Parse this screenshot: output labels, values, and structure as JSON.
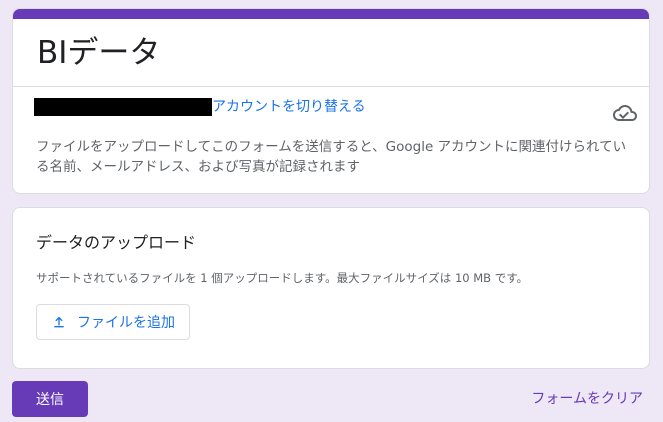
{
  "form": {
    "title": "BIデータ",
    "accent_color": "#673ab7"
  },
  "account": {
    "switch_label": "アカウントを切り替える",
    "status_icon": "cloud-check-icon"
  },
  "notice": {
    "text": "ファイルをアップロードしてこのフォームを送信すると、Google アカウントに関連付けられている名前、メールアドレス、および写真が記録されます"
  },
  "question": {
    "title": "データのアップロード",
    "description": "サポートされているファイルを 1 個アップロードします。最大ファイルサイズは 10 MB です。",
    "add_file_label": "ファイルを追加",
    "add_file_icon": "upload-icon"
  },
  "actions": {
    "submit_label": "送信",
    "clear_label": "フォームをクリア"
  }
}
